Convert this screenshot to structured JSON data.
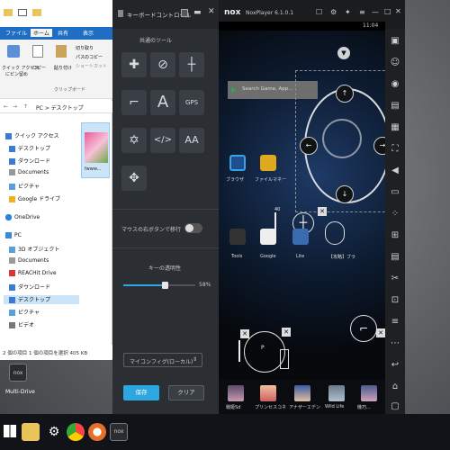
{
  "explorer": {
    "tabs": [
      "ファイル",
      "ホーム",
      "共有",
      "表示"
    ],
    "ribbon": {
      "pin_label": "クイック アクセス",
      "pin_label2": "にピン留め",
      "copy_label": "コピー",
      "paste_label": "貼り付け",
      "cut_label": "切り取り",
      "copy_path_label": "パスのコピー",
      "paste_shortcut_label": "ショートカット",
      "group_label": "クリップボード"
    },
    "address": "PC > デスクトップ",
    "thumb_label": "fwww...",
    "nav_items": [
      "クイック アクセス",
      "デスクトップ",
      "ダウンロード",
      "Documents",
      "ピクチャ",
      "Google ドライブ",
      "OneDrive",
      "PC",
      "3D オブジェクト",
      "Documents",
      "REACHit Drive",
      "ダウンロード",
      "デスクトップ",
      "ピクチャ",
      "ビデオ"
    ],
    "status": "2 個の項目   1 個の項目を選択  405 KB"
  },
  "keyboard_panel": {
    "title": "キーボードコントロール",
    "section_title": "共通のツール",
    "mouse_label": "マウスの右ボタンで移行",
    "opacity_label": "キーの透明性",
    "opacity_value": "58%",
    "opacity_fraction": 0.58,
    "config_select": "マイコンフィグ(ローカル)",
    "save_button": "保存",
    "clear_button": "クリア"
  },
  "nox": {
    "logo": "nox",
    "title": "NoxPlayer 6.1.0.1",
    "time": "11:04",
    "search_placeholder": "Search Game, App...",
    "apps_row1": [
      "ブラウザ",
      "ファイルマネー"
    ],
    "apps_row2": [
      "Tools",
      "Google",
      "Lite",
      "【攻略】ブラ"
    ],
    "dock_apps": [
      "戦姫Sd",
      "プリンセスコネ",
      "アナザーエデン",
      "Wild Life",
      "機巧…"
    ],
    "overlay_numbers": [
      "40",
      "0"
    ],
    "fire_key_label": "P"
  },
  "desktop": {
    "icon_label": "Multi-Drive",
    "icon_logo": "nox"
  },
  "taskbar": {
    "nox_label": "nox"
  }
}
